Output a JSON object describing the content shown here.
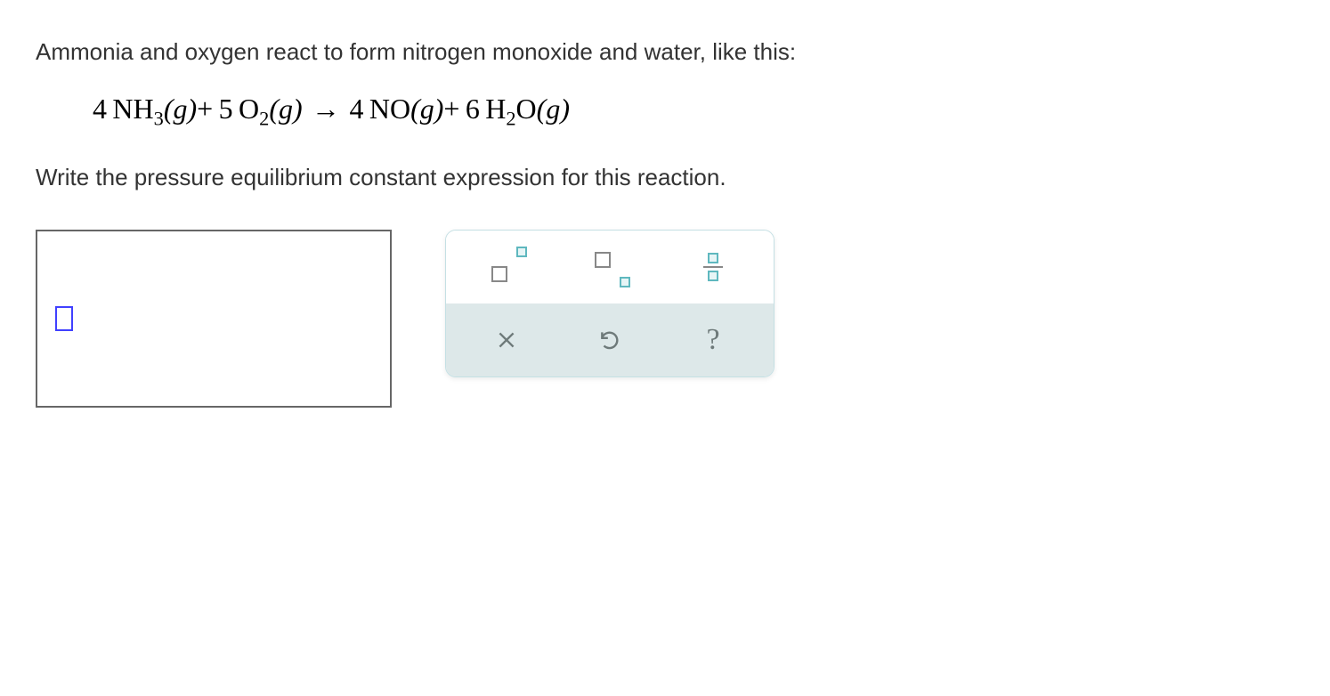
{
  "question": {
    "intro": "Ammonia and oxygen react to form nitrogen monoxide and water, like this:",
    "instruction": "Write the pressure equilibrium constant expression for this reaction."
  },
  "equation": {
    "r1_coef": "4",
    "r1_formula_base": "NH",
    "r1_formula_sub": "3",
    "r1_phase": "(g)",
    "plus1": "+",
    "r2_coef": "5",
    "r2_formula_base": "O",
    "r2_formula_sub": "2",
    "r2_phase": "(g)",
    "arrow": "→",
    "p1_coef": "4",
    "p1_formula": "NO",
    "p1_phase": "(g)",
    "plus2": "+",
    "p2_coef": "6",
    "p2_formula_base": "H",
    "p2_formula_sub": "2",
    "p2_formula_tail": "O",
    "p2_phase": "(g)"
  },
  "tools": {
    "superscript": "superscript",
    "subscript": "subscript",
    "fraction": "fraction",
    "clear": "clear",
    "undo": "undo",
    "help": "?"
  }
}
